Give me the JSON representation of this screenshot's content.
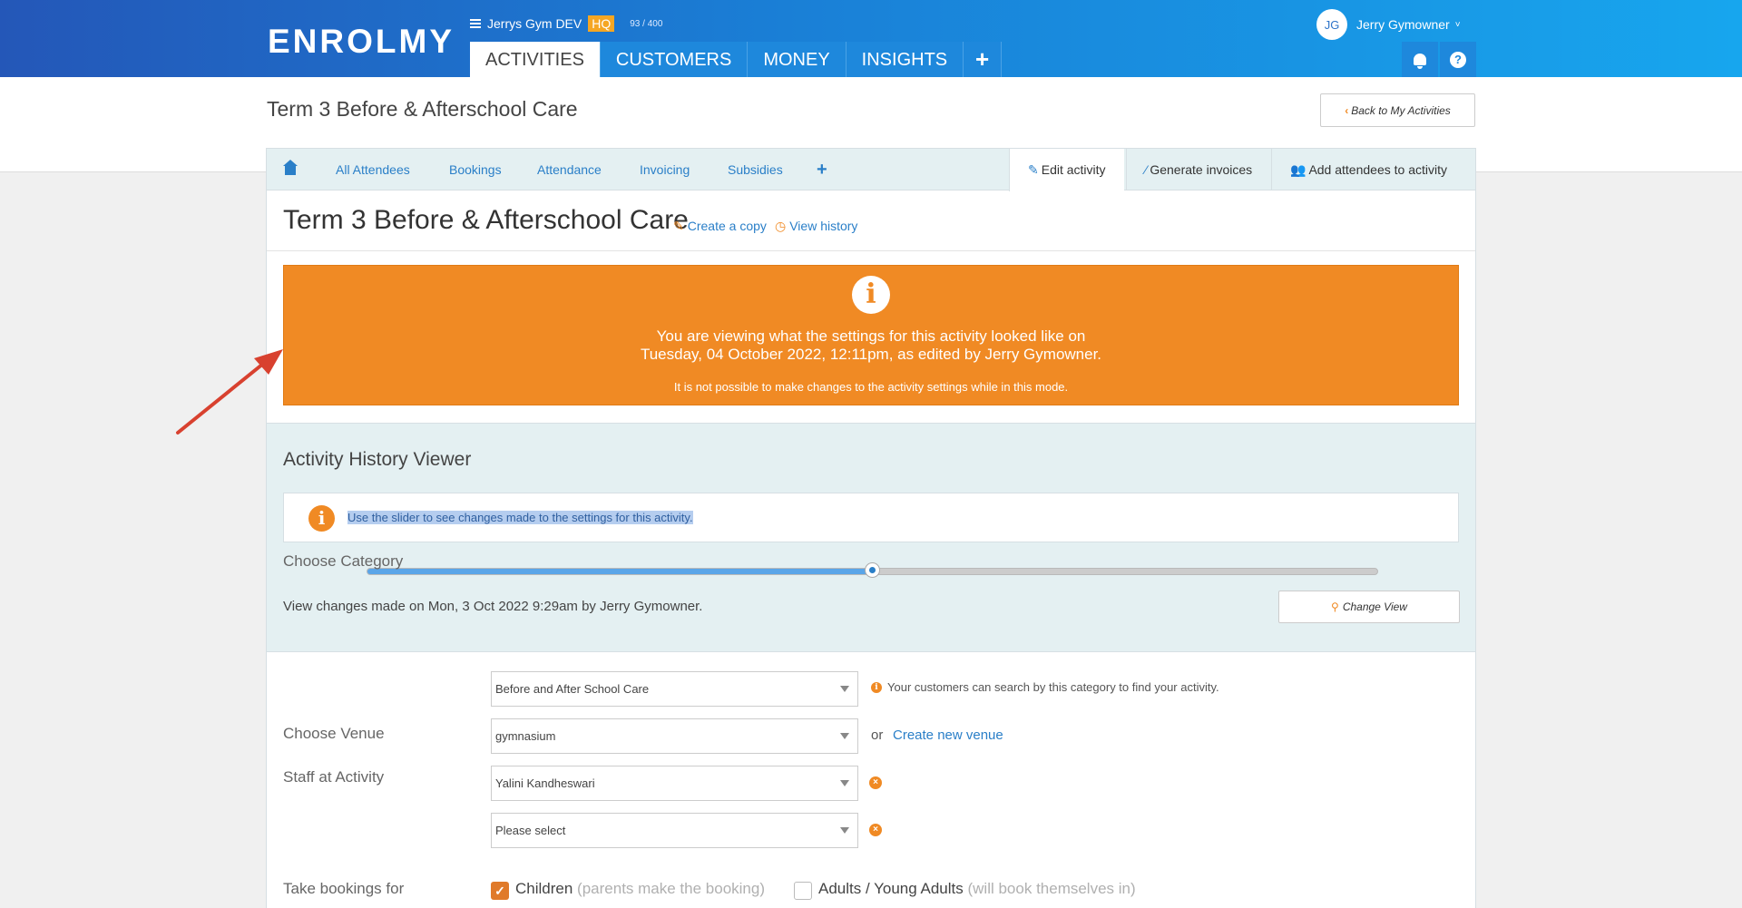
{
  "header": {
    "logo": "ENROLMY",
    "org_name": "Jerrys Gym DEV",
    "org_badge": "HQ",
    "org_count": "93 / 400",
    "nav": [
      "ACTIVITIES",
      "CUSTOMERS",
      "MONEY",
      "INSIGHTS"
    ],
    "nav_plus": "+",
    "user_initials": "JG",
    "user_name": "Jerry Gymowner",
    "user_chevron": "˅",
    "help": "?"
  },
  "page": {
    "title": "Term 3 Before & Afterschool Care",
    "back_button": "Back to My Activities",
    "back_chevron": "‹"
  },
  "subtabs": {
    "items": [
      "All Attendees",
      "Bookings",
      "Attendance",
      "Invoicing",
      "Subsidies"
    ],
    "plus": "+",
    "right": [
      {
        "label": "Edit activity",
        "icon": "pencil-icon",
        "glyph": "✎"
      },
      {
        "label": "Generate invoices",
        "icon": "magic-wand-icon",
        "glyph": "⁄"
      },
      {
        "label": "Add attendees to activity",
        "icon": "users-icon",
        "glyph": "👥"
      }
    ]
  },
  "activity": {
    "title": "Term 3 Before & Afterschool Care",
    "create_copy": "Create a copy",
    "create_copy_glyph": "✎",
    "view_history": "View history",
    "view_history_glyph": "◷"
  },
  "warning": {
    "icon_glyph": "i",
    "line1": "You are viewing what the settings for this activity looked like on",
    "line2": "Tuesday, 04 October 2022, 12:11pm, as edited by Jerry Gymowner.",
    "line3": "It is not possible to make changes to the activity settings while in this mode."
  },
  "history": {
    "title": "Activity History Viewer",
    "hint_glyph": "i",
    "hint": "Use the slider to see changes made to the settings for this activity.",
    "slider_position": 0.5,
    "changes_text": "View changes made on Mon, 3 Oct 2022 9:29am by Jerry Gymowner.",
    "change_view": "Change View",
    "change_view_glyph": "⚲"
  },
  "form": {
    "category_label": "Choose Category",
    "category_value": "Before and After School Care",
    "category_note": "Your customers can search by this category to find your activity.",
    "note_glyph": "i",
    "venue_label": "Choose Venue",
    "venue_value": "gymnasium",
    "or": "or",
    "create_venue": "Create new venue",
    "staff_label": "Staff at Activity",
    "staff_1": "Yalini Kandheswari",
    "staff_2": "Please select",
    "remove_glyph": "×",
    "bookings_label": "Take bookings for",
    "children_label": "Children",
    "children_note": "(parents make the booking)",
    "children_checked": true,
    "check_glyph": "✓",
    "adults_label": "Adults / Young Adults",
    "adults_note": "(will book themselves in)",
    "adults_checked": false
  },
  "colors": {
    "brand_blue": "#1e88dc",
    "accent_orange": "#f08a24",
    "annotation_red": "#d8412f"
  }
}
